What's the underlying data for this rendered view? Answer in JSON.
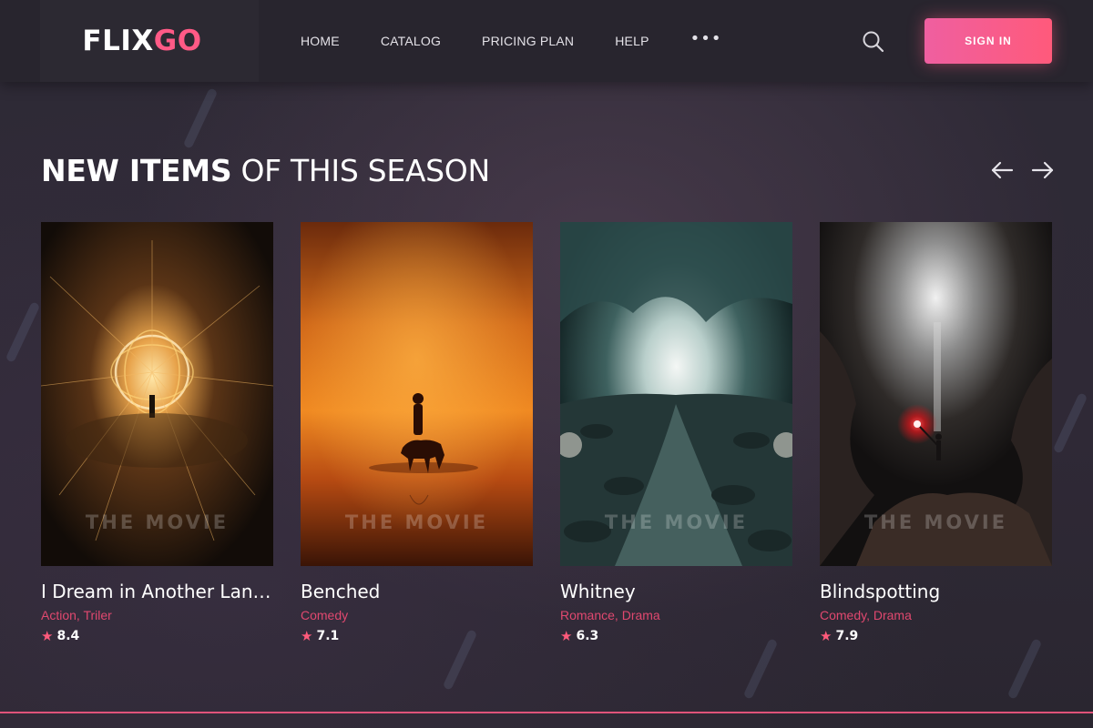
{
  "header": {
    "logo_main": "FLIX",
    "logo_accent": "GO",
    "nav": [
      {
        "label": "HOME"
      },
      {
        "label": "CATALOG"
      },
      {
        "label": "PRICING PLAN"
      },
      {
        "label": "HELP"
      }
    ],
    "more_icon": "•••",
    "search_icon": "search-icon",
    "signin_label": "SIGN IN"
  },
  "section": {
    "title_bold": "NEW ITEMS",
    "title_light": " OF THIS SEASON",
    "prev_icon": "arrow-left-icon",
    "next_icon": "arrow-right-icon"
  },
  "cards": [
    {
      "title": "I Dream in Another Language",
      "genres": [
        "Action",
        "Triler"
      ],
      "rating": "8.4",
      "watermark": "THE MOVIE"
    },
    {
      "title": "Benched",
      "genres": [
        "Comedy"
      ],
      "rating": "7.1",
      "watermark": "THE MOVIE"
    },
    {
      "title": "Whitney",
      "genres": [
        "Romance",
        "Drama"
      ],
      "rating": "6.3",
      "watermark": "THE MOVIE"
    },
    {
      "title": "Blindspotting",
      "genres": [
        "Comedy",
        "Drama"
      ],
      "rating": "7.9",
      "watermark": "THE MOVIE"
    }
  ],
  "colors": {
    "accent": "#ff5a86",
    "genre": "#e0486f",
    "header_bg": "#28252e",
    "page_bg": "#2b2733"
  }
}
